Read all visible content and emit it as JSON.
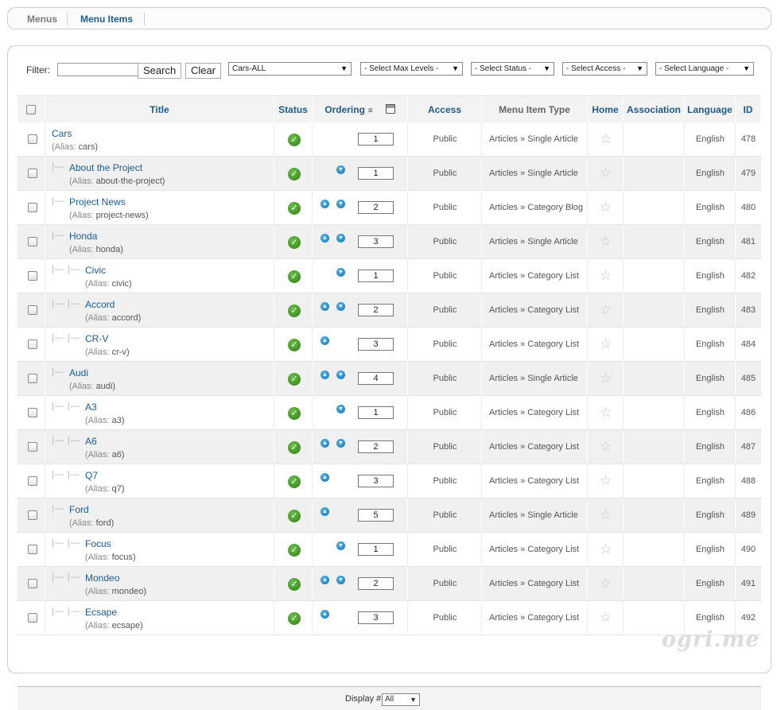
{
  "submenu": {
    "tabs": [
      "Menus",
      "Menu Items"
    ]
  },
  "filter": {
    "label": "Filter:",
    "search_value": "",
    "search_button": "Search",
    "clear_button": "Clear",
    "menu_select": "Cars-ALL",
    "max_levels": "- Select Max Levels -",
    "status": "- Select Status -",
    "access": "- Select Access -",
    "language": "- Select Language -"
  },
  "columns": {
    "title": "Title",
    "status": "Status",
    "ordering": "Ordering",
    "access": "Access",
    "type": "Menu Item Type",
    "home": "Home",
    "association": "Association",
    "language": "Language",
    "id": "ID"
  },
  "rows": [
    {
      "title": "Cars",
      "alias": "cars",
      "level": 1,
      "up": false,
      "down": false,
      "order": "1",
      "access": "Public",
      "type": "Articles » Single Article",
      "language": "English",
      "id": "478"
    },
    {
      "title": "About the Project",
      "alias": "about-the-project",
      "level": 2,
      "up": false,
      "down": true,
      "order": "1",
      "access": "Public",
      "type": "Articles » Single Article",
      "language": "English",
      "id": "479"
    },
    {
      "title": "Project News",
      "alias": "project-news",
      "level": 2,
      "up": true,
      "down": true,
      "order": "2",
      "access": "Public",
      "type": "Articles » Category Blog",
      "language": "English",
      "id": "480"
    },
    {
      "title": "Honda",
      "alias": "honda",
      "level": 2,
      "up": true,
      "down": true,
      "order": "3",
      "access": "Public",
      "type": "Articles » Single Article",
      "language": "English",
      "id": "481"
    },
    {
      "title": "Civic",
      "alias": "civic",
      "level": 3,
      "up": false,
      "down": true,
      "order": "1",
      "access": "Public",
      "type": "Articles » Category List",
      "language": "English",
      "id": "482"
    },
    {
      "title": "Accord",
      "alias": "accord",
      "level": 3,
      "up": true,
      "down": true,
      "order": "2",
      "access": "Public",
      "type": "Articles » Category List",
      "language": "English",
      "id": "483"
    },
    {
      "title": "CR-V",
      "alias": "cr-v",
      "level": 3,
      "up": true,
      "down": false,
      "order": "3",
      "access": "Public",
      "type": "Articles » Category List",
      "language": "English",
      "id": "484"
    },
    {
      "title": "Audi",
      "alias": "audi",
      "level": 2,
      "up": true,
      "down": true,
      "order": "4",
      "access": "Public",
      "type": "Articles » Single Article",
      "language": "English",
      "id": "485"
    },
    {
      "title": "A3",
      "alias": "a3",
      "level": 3,
      "up": false,
      "down": true,
      "order": "1",
      "access": "Public",
      "type": "Articles » Category List",
      "language": "English",
      "id": "486"
    },
    {
      "title": "A6",
      "alias": "a6",
      "level": 3,
      "up": true,
      "down": true,
      "order": "2",
      "access": "Public",
      "type": "Articles » Category List",
      "language": "English",
      "id": "487"
    },
    {
      "title": "Q7",
      "alias": "q7",
      "level": 3,
      "up": true,
      "down": false,
      "order": "3",
      "access": "Public",
      "type": "Articles » Category List",
      "language": "English",
      "id": "488"
    },
    {
      "title": "Ford",
      "alias": "ford",
      "level": 2,
      "up": true,
      "down": false,
      "order": "5",
      "access": "Public",
      "type": "Articles » Single Article",
      "language": "English",
      "id": "489"
    },
    {
      "title": "Focus",
      "alias": "focus",
      "level": 3,
      "up": false,
      "down": true,
      "order": "1",
      "access": "Public",
      "type": "Articles » Category List",
      "language": "English",
      "id": "490"
    },
    {
      "title": "Mondeo",
      "alias": "mondeo",
      "level": 3,
      "up": true,
      "down": true,
      "order": "2",
      "access": "Public",
      "type": "Articles » Category List",
      "language": "English",
      "id": "491"
    },
    {
      "title": "Ecsape",
      "alias": "ecsape",
      "level": 3,
      "up": true,
      "down": false,
      "order": "3",
      "access": "Public",
      "type": "Articles » Category List",
      "language": "English",
      "id": "492"
    }
  ],
  "alias_prefix": "(Alias:",
  "footer": {
    "display_label": "Display #",
    "display_value": "All"
  },
  "watermark": "ogri.me",
  "icons": {
    "status": "published-check-icon",
    "home": "home-star-icon",
    "up": "move-up-icon",
    "down": "move-down-icon"
  },
  "colors": {
    "link": "#1d5b8a",
    "published": "#2e7d12",
    "arrow": "#1373b4"
  }
}
